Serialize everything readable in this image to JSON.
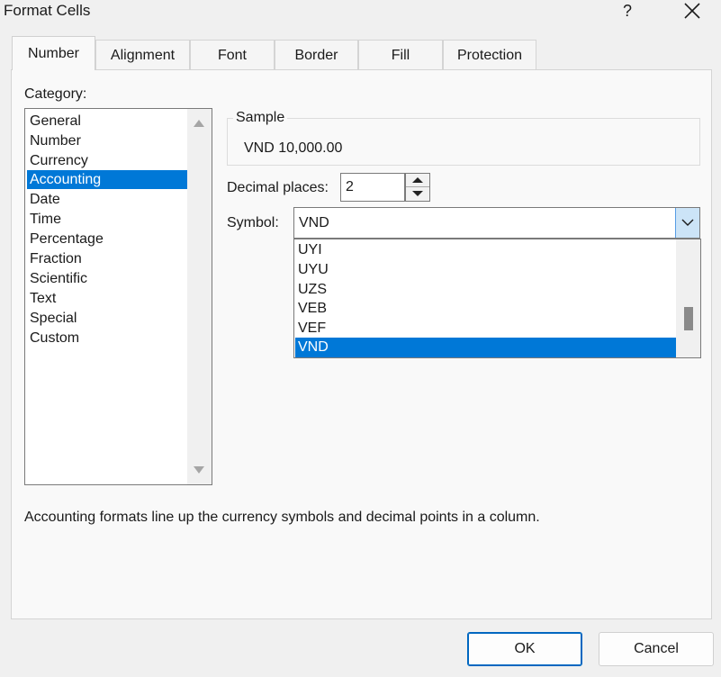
{
  "window": {
    "title": "Format Cells",
    "help_label": "?"
  },
  "tabs": [
    {
      "label": "Number"
    },
    {
      "label": "Alignment"
    },
    {
      "label": "Font"
    },
    {
      "label": "Border"
    },
    {
      "label": "Fill"
    },
    {
      "label": "Protection"
    }
  ],
  "category": {
    "label": "Category:",
    "selected": "Accounting",
    "items": [
      "General",
      "Number",
      "Currency",
      "Accounting",
      "Date",
      "Time",
      "Percentage",
      "Fraction",
      "Scientific",
      "Text",
      "Special",
      "Custom"
    ]
  },
  "sample": {
    "label": "Sample",
    "value": "VND 10,000.00"
  },
  "decimal_places": {
    "label": "Decimal places:",
    "value": "2"
  },
  "symbol": {
    "label": "Symbol:",
    "value": "VND",
    "options": [
      "UYI",
      "UYU",
      "UZS",
      "VEB",
      "VEF",
      "VND"
    ],
    "selected": "VND"
  },
  "description": "Accounting formats line up the currency symbols and decimal points in a column.",
  "buttons": {
    "ok": "OK",
    "cancel": "Cancel"
  },
  "colors": {
    "selection": "#0078d7",
    "dialog_bg": "#f0f0f0",
    "panel_bg": "#f9f9f9"
  }
}
